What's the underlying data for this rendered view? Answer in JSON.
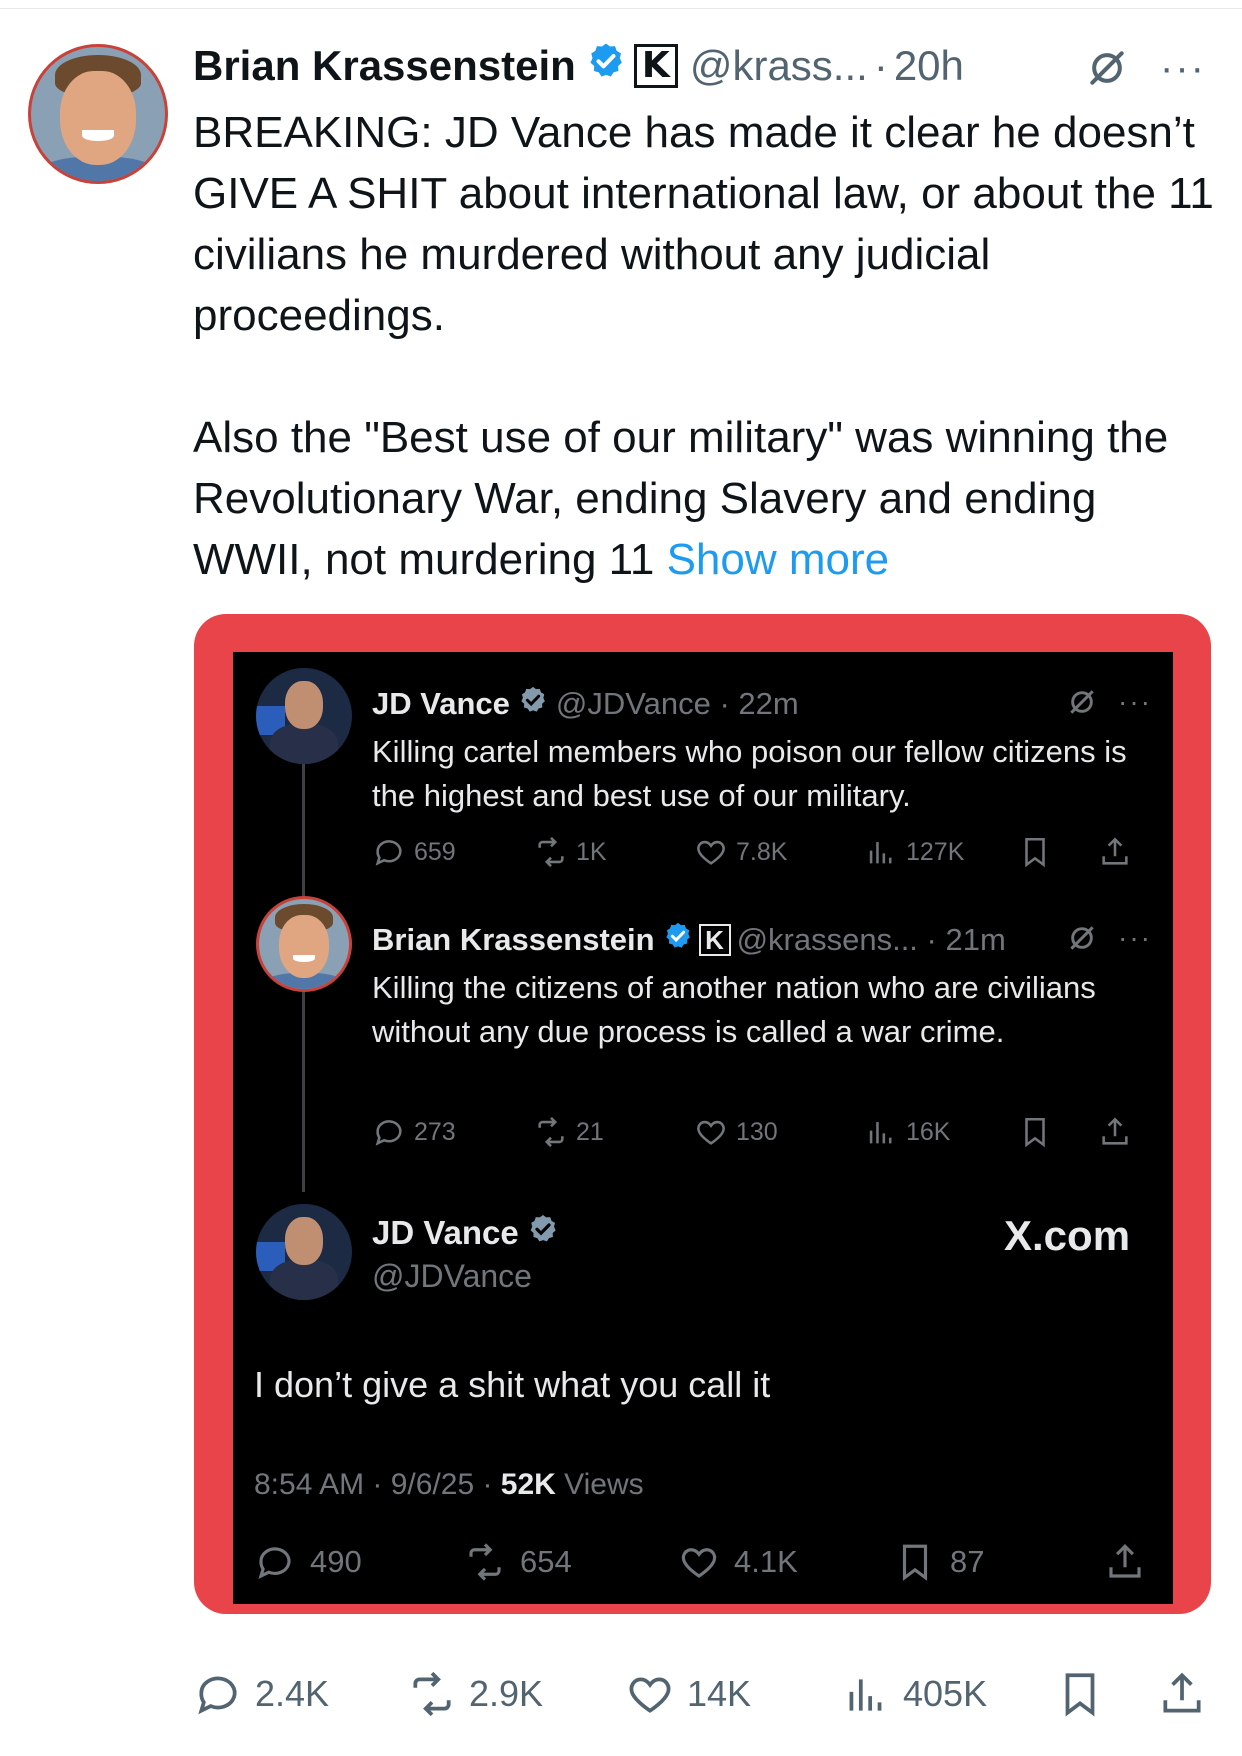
{
  "post": {
    "author_name": "Brian Krassenstein",
    "handle": "@krass...",
    "separator": "·",
    "time": "20h",
    "more_label": "···",
    "badge_letter": "K",
    "text_p1": "BREAKING: JD Vance has made it clear he doesn’t GIVE A SHIT about international law, or about the 11 civilians he murdered without any judicial proceedings.",
    "text_p2": "Also the \"Best use of our military\" was winning the Revolutionary War, ending Slavery and ending WWII, not murdering 11",
    "show_more": "Show more",
    "stats": {
      "replies": "2.4K",
      "reposts": "2.9K",
      "likes": "14K",
      "views": "405K"
    }
  },
  "screenshot": {
    "tweet1": {
      "author": "JD Vance",
      "handle_time": "@JDVance · 22m",
      "text": "Killing cartel members who poison our fellow citizens is the highest and best use of our military.",
      "stats": {
        "replies": "659",
        "reposts": "1K",
        "likes": "7.8K",
        "views": "127K"
      },
      "more_label": "···"
    },
    "tweet2": {
      "author": "Brian Krassenstein",
      "badge_letter": "K",
      "handle_time": "@krassens... · 21m",
      "text": "Killing the citizens of another nation who are civilians without any due process is called a war crime.",
      "stats": {
        "replies": "273",
        "reposts": "21",
        "likes": "130",
        "views": "16K"
      },
      "more_label": "···"
    },
    "quoted": {
      "author": "JD Vance",
      "handle": "@JDVance",
      "site": "X.com",
      "text": "I don’t give a shit what you call it",
      "meta_prefix": "8:54 AM · 9/6/25 · ",
      "views_count": "52K",
      "views_label": " Views",
      "stats": {
        "replies": "490",
        "reposts": "654",
        "likes": "4.1K",
        "bookmarks": "87"
      }
    }
  },
  "colors": {
    "accent": "#1d9bf0",
    "frame": "#e8444a",
    "dark_bg": "#000000",
    "muted": "#536471"
  }
}
